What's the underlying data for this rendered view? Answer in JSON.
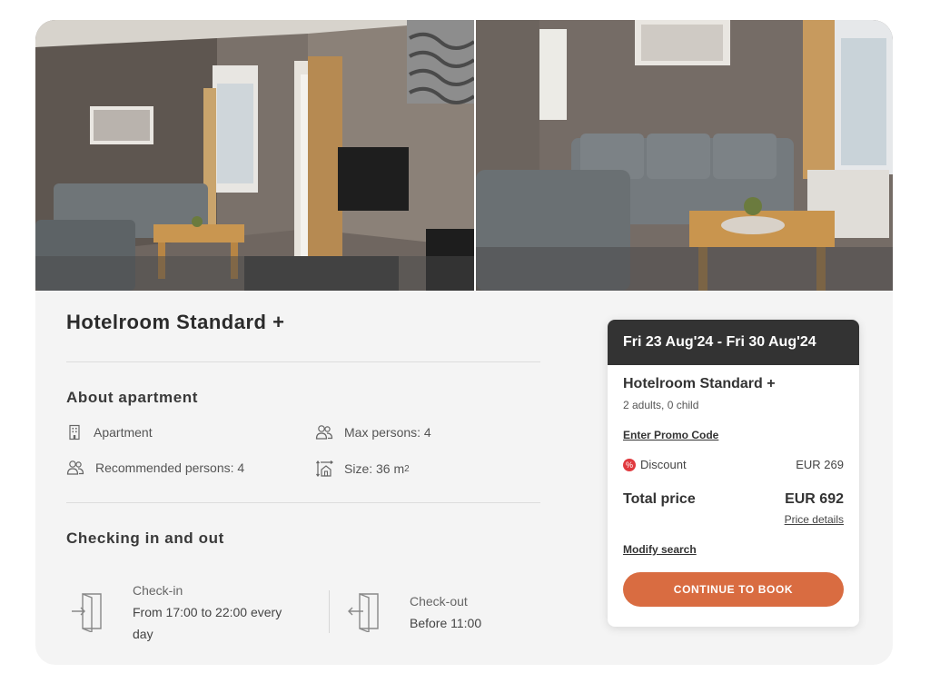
{
  "room": {
    "title": "Hotelroom Standard +"
  },
  "about": {
    "heading": "About apartment",
    "features": [
      {
        "icon": "building-icon",
        "text": "Apartment"
      },
      {
        "icon": "persons-icon",
        "text": "Max persons: 4"
      },
      {
        "icon": "persons-icon",
        "text": "Recommended persons: 4"
      },
      {
        "icon": "room-size-icon",
        "text": "Size: 36 m",
        "sup": "2"
      }
    ]
  },
  "checking": {
    "heading": "Checking in and out",
    "checkin": {
      "label": "Check-in",
      "line1": "From 17:00 to 22:00 every",
      "line2": "day"
    },
    "checkout": {
      "label": "Check-out",
      "value": "Before 11:00"
    }
  },
  "booking": {
    "dates": "Fri 23 Aug'24 - Fri 30 Aug'24",
    "room": "Hotelroom Standard +",
    "guests": "2 adults, 0 child",
    "promo_link": "Enter Promo Code",
    "discount_label": "Discount",
    "discount_value": "EUR 269",
    "total_label": "Total price",
    "total_value": "EUR 692",
    "price_details_link": "Price details",
    "modify_link": "Modify search",
    "cta": "CONTINUE TO BOOK"
  },
  "colors": {
    "accent": "#d96c41",
    "header_dark": "#333333",
    "discount_icon": "#e0393e"
  }
}
